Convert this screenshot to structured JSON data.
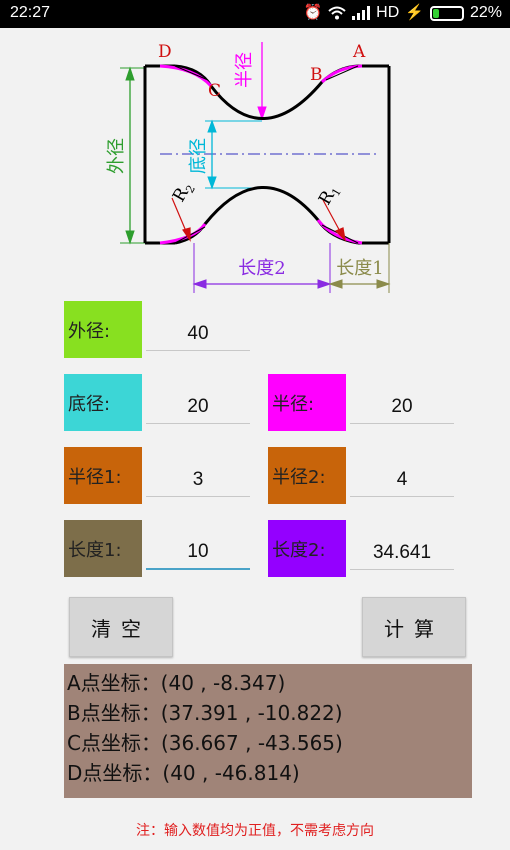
{
  "status_bar": {
    "time": "22:27",
    "network": "HD",
    "battery": "22%",
    "battery_level": 0.22,
    "icons": [
      "alarm-icon",
      "wifi-icon",
      "signal-icon",
      "charging-icon",
      "battery-icon"
    ]
  },
  "diagram": {
    "labels": {
      "A": "A",
      "B": "B",
      "C": "C",
      "D": "D",
      "outer": "外径",
      "base": "底径",
      "radius": "半径",
      "r1": "R",
      "r1_sub": "1",
      "r2": "R",
      "r2_sub": "2",
      "length2": "长度2",
      "length1": "长度1"
    },
    "colors": {
      "outline": "#000000",
      "arc": "#ff00ff",
      "dim_green": "#2e9e2e",
      "dim_cyan": "#00b8d8",
      "dim_violet": "#8a2be2",
      "dim_olive": "#8b8b4b",
      "centerline": "#3030c0"
    }
  },
  "fields": {
    "outer_diameter": {
      "label": "外径:",
      "value": "40",
      "color": "#88e020"
    },
    "base_diameter": {
      "label": "底径:",
      "value": "20",
      "color": "#3cd6d6"
    },
    "radius": {
      "label": "半径:",
      "value": "20",
      "color": "#ff00ff"
    },
    "radius1": {
      "label": "半径1:",
      "value": "3",
      "color": "#c8640a"
    },
    "radius2": {
      "label": "半径2:",
      "value": "4",
      "color": "#c8640a"
    },
    "length1": {
      "label": "长度1:",
      "value": "10",
      "color": "#7d6e4a"
    },
    "length2": {
      "label": "长度2:",
      "value": "34.641",
      "color": "#9400ff"
    }
  },
  "buttons": {
    "clear": "清空",
    "calculate": "计算"
  },
  "results": {
    "background": "#a08478",
    "lines": [
      "A点坐标：(40 , -8.347)",
      "B点坐标：(37.391 , -10.822)",
      "C点坐标：(36.667 , -43.565)",
      "D点坐标：(40 , -46.814)"
    ]
  },
  "note": "注：输入数值均为正值，不需考虑方向"
}
